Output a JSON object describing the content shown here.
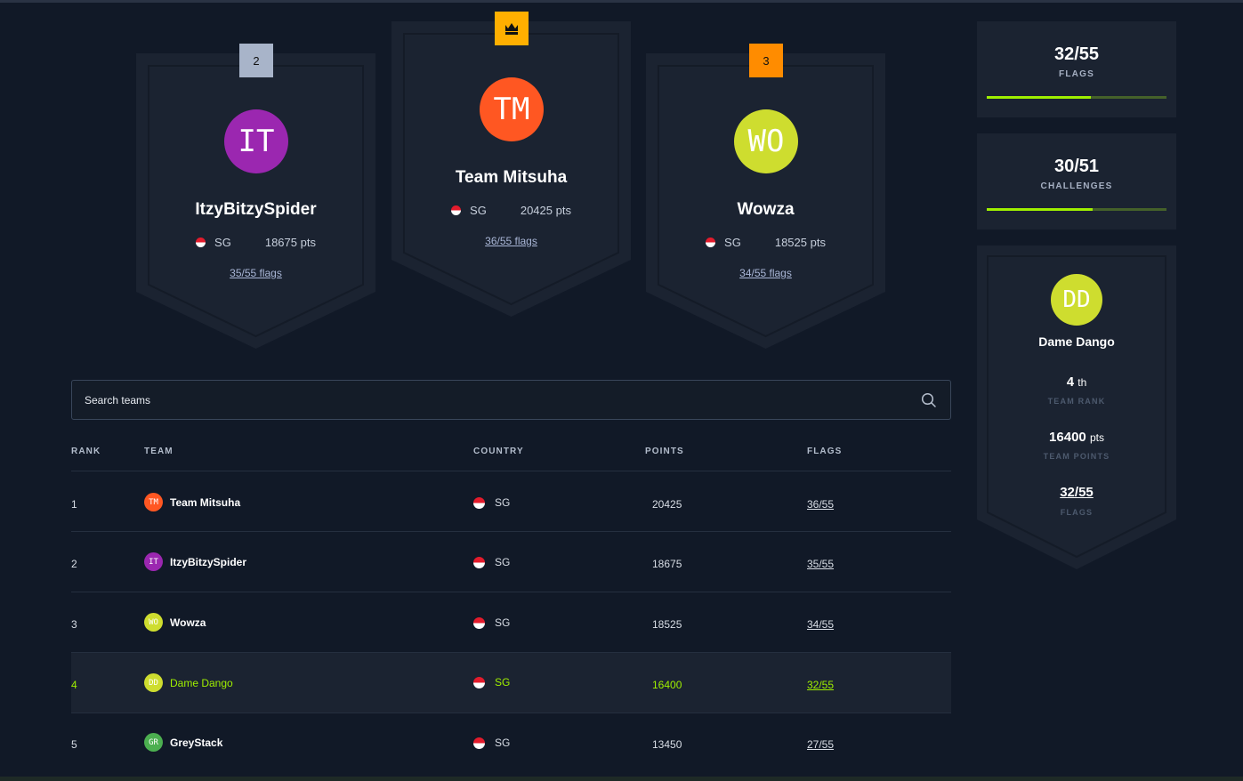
{
  "podium": [
    {
      "rank_badge": "2",
      "initials": "IT",
      "name": "ItzyBitzySpider",
      "country": "SG",
      "points": "18675 pts",
      "flags": "35/55 flags",
      "avatar_color": "#9b27b0",
      "badge_color": "#a8b4c9"
    },
    {
      "rank_badge": "",
      "initials": "TM",
      "name": "Team Mitsuha",
      "country": "SG",
      "points": "20425 pts",
      "flags": "36/55 flags",
      "avatar_color": "#ff5722",
      "badge_color": "#ffaf00",
      "badge_icon": "crown-icon"
    },
    {
      "rank_badge": "3",
      "initials": "WO",
      "name": "Wowza",
      "country": "SG",
      "points": "18525 pts",
      "flags": "34/55 flags",
      "avatar_color": "#cedd2f",
      "badge_color": "#ff8c00"
    }
  ],
  "stats": {
    "flags": {
      "value": "32/55",
      "label": "FLAGS",
      "progress": 0.58
    },
    "challenges": {
      "value": "30/51",
      "label": "CHALLENGES",
      "progress": 0.59
    }
  },
  "team_card": {
    "initials": "DD",
    "name": "Dame Dango",
    "rank_value": "4",
    "rank_suffix": "th",
    "rank_label": "TEAM RANK",
    "points_value": "16400",
    "points_suffix": "pts",
    "points_label": "TEAM POINTS",
    "flags_value": "32/55",
    "flags_label": "FLAGS"
  },
  "search": {
    "placeholder": "Search teams"
  },
  "table": {
    "headers": {
      "rank": "RANK",
      "team": "TEAM",
      "country": "COUNTRY",
      "points": "POINTS",
      "flags": "FLAGS"
    },
    "rows": [
      {
        "rank": "1",
        "initials": "TM",
        "team": "Team Mitsuha",
        "country": "SG",
        "points": "20425",
        "flags": "36/55",
        "avatar_color": "#ff5722"
      },
      {
        "rank": "2",
        "initials": "IT",
        "team": "ItzyBitzySpider",
        "country": "SG",
        "points": "18675",
        "flags": "35/55",
        "avatar_color": "#9b27b0"
      },
      {
        "rank": "3",
        "initials": "WO",
        "team": "Wowza",
        "country": "SG",
        "points": "18525",
        "flags": "34/55",
        "avatar_color": "#cedd2f"
      },
      {
        "rank": "4",
        "initials": "DD",
        "team": "Dame Dango",
        "country": "SG",
        "points": "16400",
        "flags": "32/55",
        "avatar_color": "#cedd2f"
      },
      {
        "rank": "5",
        "initials": "GR",
        "team": "GreyStack",
        "country": "SG",
        "points": "13450",
        "flags": "27/55",
        "avatar_color": "#4caf50"
      }
    ]
  },
  "colors": {
    "accent": "#9fef00",
    "background": "#111927",
    "card": "#1b2331"
  }
}
